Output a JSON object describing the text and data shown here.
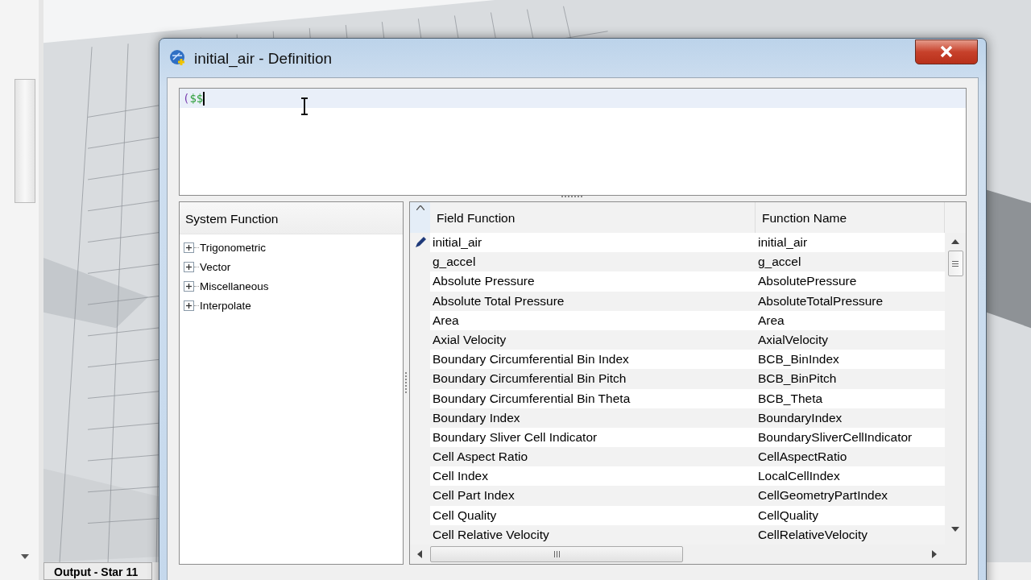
{
  "background": {
    "output_tab": "Output - Star 11"
  },
  "dialog": {
    "title": "initial_air - Definition",
    "expression": [
      {
        "kind": "paren",
        "text": "("
      },
      {
        "kind": "variable",
        "text": "$$"
      }
    ],
    "system_function": {
      "heading": "System Function",
      "items": [
        {
          "label": "Trigonometric",
          "expanded": false
        },
        {
          "label": "Vector",
          "expanded": false
        },
        {
          "label": "Miscellaneous",
          "expanded": false
        },
        {
          "label": "Interpolate",
          "expanded": false
        }
      ]
    },
    "table": {
      "columns": [
        "Field Function",
        "Function Name"
      ],
      "rows": [
        {
          "field_function": "initial_air",
          "function_name": "initial_air",
          "editing": true
        },
        {
          "field_function": "g_accel",
          "function_name": "g_accel",
          "editing": false
        },
        {
          "field_function": "Absolute Pressure",
          "function_name": "AbsolutePressure",
          "editing": false
        },
        {
          "field_function": "Absolute Total Pressure",
          "function_name": "AbsoluteTotalPressure",
          "editing": false
        },
        {
          "field_function": "Area",
          "function_name": "Area",
          "editing": false
        },
        {
          "field_function": "Axial Velocity",
          "function_name": "AxialVelocity",
          "editing": false
        },
        {
          "field_function": "Boundary Circumferential Bin Index",
          "function_name": "BCB_BinIndex",
          "editing": false
        },
        {
          "field_function": "Boundary Circumferential Bin Pitch",
          "function_name": "BCB_BinPitch",
          "editing": false
        },
        {
          "field_function": "Boundary Circumferential Bin Theta",
          "function_name": "BCB_Theta",
          "editing": false
        },
        {
          "field_function": "Boundary Index",
          "function_name": "BoundaryIndex",
          "editing": false
        },
        {
          "field_function": "Boundary Sliver Cell Indicator",
          "function_name": "BoundarySliverCellIndicator",
          "editing": false
        },
        {
          "field_function": "Cell Aspect Ratio",
          "function_name": "CellAspectRatio",
          "editing": false
        },
        {
          "field_function": "Cell Index",
          "function_name": "LocalCellIndex",
          "editing": false
        },
        {
          "field_function": "Cell Part Index",
          "function_name": "CellGeometryPartIndex",
          "editing": false
        },
        {
          "field_function": "Cell Quality",
          "function_name": "CellQuality",
          "editing": false
        },
        {
          "field_function": "Cell Relative Velocity",
          "function_name": "CellRelativeVelocity",
          "editing": false
        }
      ]
    }
  }
}
